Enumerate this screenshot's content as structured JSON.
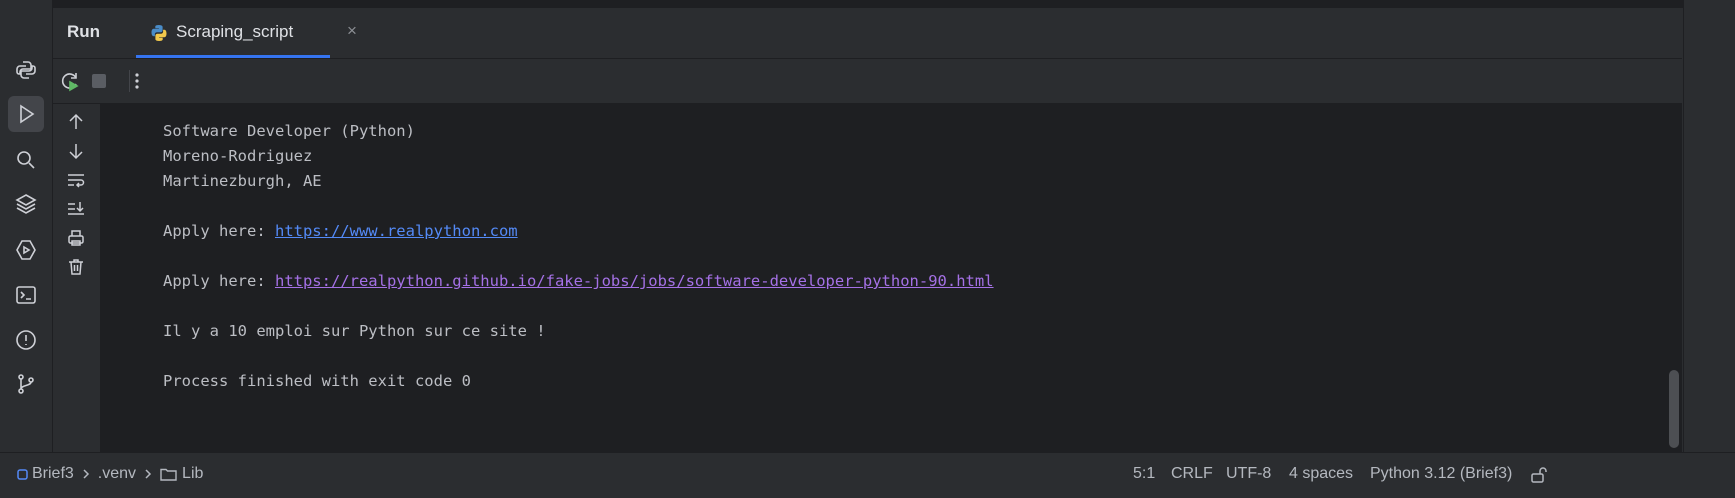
{
  "tool_window": {
    "title": "Run",
    "tab": {
      "label": "Scraping_script",
      "close": "×"
    }
  },
  "console": {
    "lines": [
      {
        "text": "Software Developer (Python)"
      },
      {
        "text": "Moreno-Rodriguez"
      },
      {
        "text": "Martinezburgh, AE"
      },
      {
        "prefix": "Apply here: ",
        "link": "https://www.realpython.com"
      },
      {
        "prefix": "Apply here: ",
        "link": "https://realpython.github.io/fake-jobs/jobs/software-developer-python-90.html"
      },
      {
        "text": "Il y a 10 emploi sur Python sur ce site !"
      },
      {
        "text": "Process finished with exit code 0"
      }
    ]
  },
  "breadcrumb": {
    "project": "Brief3",
    "folder1": ".venv",
    "folder2": "Lib"
  },
  "status": {
    "position": "5:1",
    "line_sep": "CRLF",
    "encoding": "UTF-8",
    "indent": "4 spaces",
    "interpreter": "Python 3.12 (Brief3)"
  },
  "colors": {
    "accent": "#3574f0",
    "link": "#548af7",
    "visited_link": "#a571e6",
    "run_green": "#5fb865"
  }
}
